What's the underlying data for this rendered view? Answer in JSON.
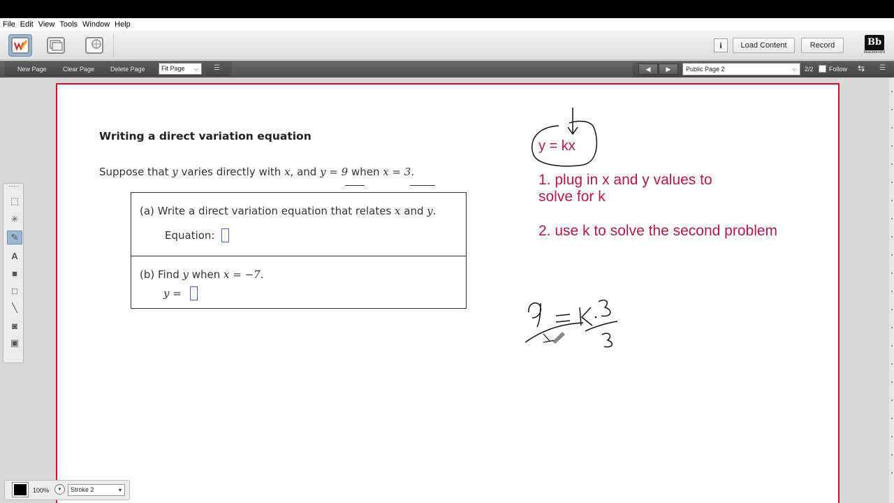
{
  "menu": [
    "File",
    "Edit",
    "View",
    "Tools",
    "Window",
    "Help"
  ],
  "toolbar": {
    "info_label": "i",
    "load_content": "Load Content",
    "record": "Record",
    "brand": "Bb",
    "brand_sub": "Blackboard"
  },
  "subbar": {
    "new_page": "New Page",
    "clear_page": "Clear Page",
    "delete_page": "Delete Page",
    "fit_page": "Fit Page",
    "page_select": "Public Page 2",
    "page_count": "2/2",
    "follow": "Follow"
  },
  "bottom": {
    "zoom": "100%",
    "stroke": "Stroke 2"
  },
  "problem": {
    "title": "Writing a direct variation equation",
    "statement_pre": "Suppose that ",
    "statement_y": "y",
    "statement_mid": " varies directly with ",
    "statement_x": "x",
    "statement_and": ", and ",
    "statement_eq1": "y = 9",
    "statement_when": " when ",
    "statement_eq2": "x = 3",
    "statement_end": ".",
    "part_a_prefix": "(a) Write a direct variation equation that relates ",
    "part_a_x": "x",
    "part_a_and": " and ",
    "part_a_y": "y",
    "part_a_end": ".",
    "equation_label": "Equation: ",
    "part_b_prefix": "(b) Find ",
    "part_b_y": "y",
    "part_b_mid": " when ",
    "part_b_eq": "x = −7",
    "part_b_end": ".",
    "y_equals": "y = "
  },
  "annotations": {
    "formula": "y = kx",
    "step1_line1": "1. plug in x and y values to",
    "step1_line2": "solve for k",
    "step2": "2. use k to solve the second problem"
  },
  "colors": {
    "ink": "#b5174a",
    "border": "#c8102e",
    "answer_box": "#4b5fb8"
  }
}
